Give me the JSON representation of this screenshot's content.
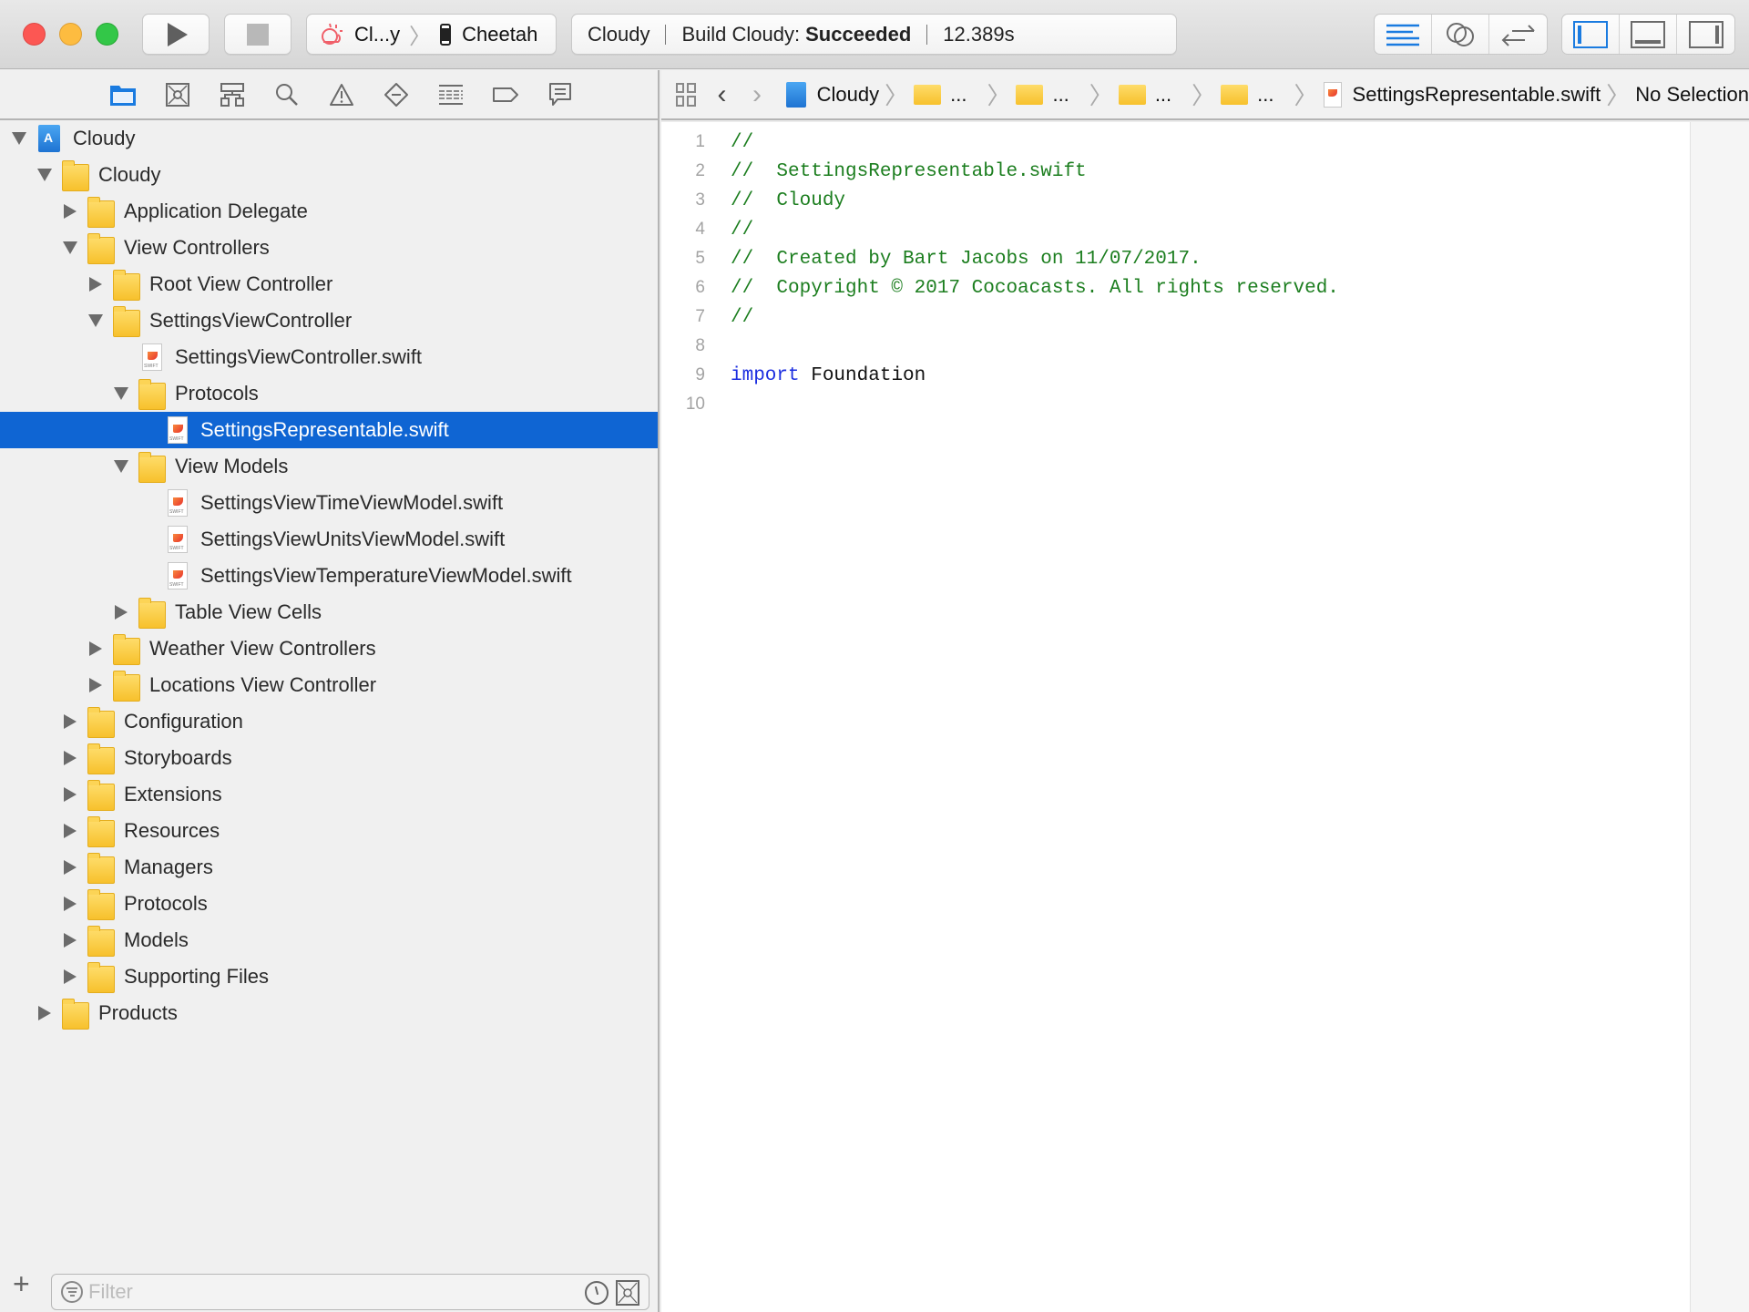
{
  "toolbar": {
    "window_controls": [
      "close",
      "minimize",
      "maximize"
    ],
    "run_icon": "play-icon",
    "stop_icon": "stop-icon",
    "scheme": {
      "app_icon": "cloud-sun-icon",
      "name": "Cl...y",
      "device_icon": "iphone-icon",
      "device": "Cheetah"
    },
    "status": {
      "project": "Cloudy",
      "prefix": "Build Cloudy:",
      "result": "Succeeded",
      "duration": "12.389s"
    },
    "editor_modes": [
      {
        "name": "standard-editor",
        "icon": "lines-icon",
        "active": true
      },
      {
        "name": "assistant-editor",
        "icon": "rings-icon",
        "active": false
      },
      {
        "name": "version-editor",
        "icon": "arrows-icon",
        "active": false
      }
    ],
    "view_toggles": [
      {
        "name": "navigator",
        "icon": "left-panel-icon",
        "active": true
      },
      {
        "name": "debug-area",
        "icon": "bottom-panel-icon",
        "active": false
      },
      {
        "name": "utilities",
        "icon": "right-panel-icon",
        "active": false
      }
    ]
  },
  "navigator": {
    "tabs": [
      {
        "name": "project",
        "icon": "folder-icon",
        "active": true
      },
      {
        "name": "source-control",
        "icon": "source-control-icon",
        "active": false
      },
      {
        "name": "symbol",
        "icon": "hierarchy-icon",
        "active": false
      },
      {
        "name": "find",
        "icon": "search-icon",
        "active": false
      },
      {
        "name": "issue",
        "icon": "warning-icon",
        "active": false
      },
      {
        "name": "test",
        "icon": "test-diamond-icon",
        "active": false
      },
      {
        "name": "debug",
        "icon": "debug-list-icon",
        "active": false
      },
      {
        "name": "breakpoint",
        "icon": "breakpoint-tag-icon",
        "active": false
      },
      {
        "name": "report",
        "icon": "report-bubble-icon",
        "active": false
      }
    ],
    "tree": [
      {
        "label": "Cloudy",
        "level": 0,
        "type": "project",
        "state": "expanded"
      },
      {
        "label": "Cloudy",
        "level": 1,
        "type": "folder",
        "state": "expanded"
      },
      {
        "label": "Application Delegate",
        "level": 2,
        "type": "folder",
        "state": "collapsed"
      },
      {
        "label": "View Controllers",
        "level": 2,
        "type": "folder",
        "state": "expanded"
      },
      {
        "label": "Root View Controller",
        "level": 3,
        "type": "folder",
        "state": "collapsed"
      },
      {
        "label": "SettingsViewController",
        "level": 3,
        "type": "folder",
        "state": "expanded"
      },
      {
        "label": "SettingsViewController.swift",
        "level": 4,
        "type": "swift",
        "state": "none"
      },
      {
        "label": "Protocols",
        "level": 4,
        "type": "folder",
        "state": "expanded"
      },
      {
        "label": "SettingsRepresentable.swift",
        "level": 5,
        "type": "swift",
        "state": "none",
        "selected": true
      },
      {
        "label": "View Models",
        "level": 4,
        "type": "folder",
        "state": "expanded"
      },
      {
        "label": "SettingsViewTimeViewModel.swift",
        "level": 5,
        "type": "swift",
        "state": "none"
      },
      {
        "label": "SettingsViewUnitsViewModel.swift",
        "level": 5,
        "type": "swift",
        "state": "none"
      },
      {
        "label": "SettingsViewTemperatureViewModel.swift",
        "level": 5,
        "type": "swift",
        "state": "none"
      },
      {
        "label": "Table View Cells",
        "level": 4,
        "type": "folder",
        "state": "collapsed"
      },
      {
        "label": "Weather View Controllers",
        "level": 3,
        "type": "folder",
        "state": "collapsed"
      },
      {
        "label": "Locations View Controller",
        "level": 3,
        "type": "folder",
        "state": "collapsed"
      },
      {
        "label": "Configuration",
        "level": 2,
        "type": "folder",
        "state": "collapsed"
      },
      {
        "label": "Storyboards",
        "level": 2,
        "type": "folder",
        "state": "collapsed"
      },
      {
        "label": "Extensions",
        "level": 2,
        "type": "folder",
        "state": "collapsed"
      },
      {
        "label": "Resources",
        "level": 2,
        "type": "folder",
        "state": "collapsed"
      },
      {
        "label": "Managers",
        "level": 2,
        "type": "folder",
        "state": "collapsed"
      },
      {
        "label": "Protocols",
        "level": 2,
        "type": "folder",
        "state": "collapsed"
      },
      {
        "label": "Models",
        "level": 2,
        "type": "folder",
        "state": "collapsed"
      },
      {
        "label": "Supporting Files",
        "level": 2,
        "type": "folder",
        "state": "collapsed"
      },
      {
        "label": "Products",
        "level": 1,
        "type": "folder",
        "state": "collapsed"
      }
    ],
    "filter": {
      "placeholder": "Filter",
      "value": ""
    },
    "add_label": "+"
  },
  "jumpbar": {
    "items": [
      {
        "type": "project",
        "label": "Cloudy"
      },
      {
        "type": "folder",
        "label": "..."
      },
      {
        "type": "folder",
        "label": "..."
      },
      {
        "type": "folder",
        "label": "..."
      },
      {
        "type": "folder",
        "label": "..."
      },
      {
        "type": "swift",
        "label": "SettingsRepresentable.swift"
      },
      {
        "type": "text",
        "label": "No Selection"
      }
    ],
    "back": "‹",
    "forward": "›"
  },
  "editor": {
    "lines": [
      {
        "n": "1",
        "parts": [
          {
            "t": "//",
            "c": "comment"
          }
        ]
      },
      {
        "n": "2",
        "parts": [
          {
            "t": "//  SettingsRepresentable.swift",
            "c": "comment"
          }
        ]
      },
      {
        "n": "3",
        "parts": [
          {
            "t": "//  Cloudy",
            "c": "comment"
          }
        ]
      },
      {
        "n": "4",
        "parts": [
          {
            "t": "//",
            "c": "comment"
          }
        ]
      },
      {
        "n": "5",
        "parts": [
          {
            "t": "//  Created by Bart Jacobs on 11/07/2017.",
            "c": "comment"
          }
        ]
      },
      {
        "n": "6",
        "parts": [
          {
            "t": "//  Copyright © 2017 Cocoacasts. All rights reserved.",
            "c": "comment"
          }
        ]
      },
      {
        "n": "7",
        "parts": [
          {
            "t": "//",
            "c": "comment"
          }
        ]
      },
      {
        "n": "8",
        "parts": []
      },
      {
        "n": "9",
        "parts": [
          {
            "t": "import",
            "c": "kw"
          },
          {
            "t": " Foundation",
            "c": "plain"
          }
        ]
      },
      {
        "n": "10",
        "parts": []
      }
    ]
  },
  "colors": {
    "selection": "#0f65d3",
    "comment": "#1c7e1f",
    "keyword": "#1c2ee0",
    "active_icon": "#1a7be0",
    "folder": "#f7c12c"
  }
}
